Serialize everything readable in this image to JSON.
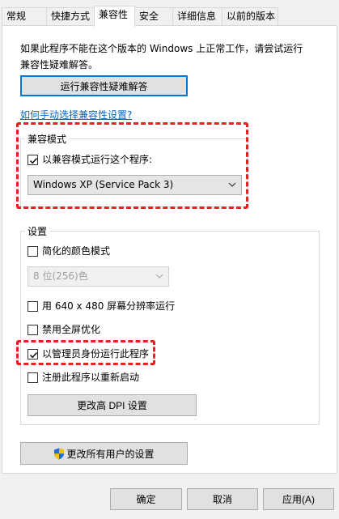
{
  "tabs": [
    "常规",
    "快捷方式",
    "兼容性",
    "安全",
    "详细信息",
    "以前的版本"
  ],
  "active_tab": "兼容性",
  "intro_text": "如果此程序不能在这个版本的 Windows 上正常工作，请尝试运行兼容性疑难解答。",
  "troubleshooter_button": "运行兼容性疑难解答",
  "manual_link": "如何手动选择兼容性设置?",
  "compat_mode": {
    "title": "兼容模式",
    "checkbox_label": "以兼容模式运行这个程序:",
    "checked": true,
    "selected_os": "Windows XP (Service Pack 3)"
  },
  "settings": {
    "title": "设置",
    "reduced_color": {
      "label": "简化的颜色模式",
      "checked": false
    },
    "color_select": "8 位(256)色",
    "run_640": {
      "label": "用 640 x 480 屏幕分辨率运行",
      "checked": false
    },
    "disable_fullscreen": {
      "label": "禁用全屏优化",
      "checked": false
    },
    "run_as_admin": {
      "label": "以管理员身份运行此程序",
      "checked": true
    },
    "register_restart": {
      "label": "注册此程序以重新启动",
      "checked": false
    },
    "dpi_button": "更改高 DPI 设置"
  },
  "all_users_button": "更改所有用户的设置",
  "footer": {
    "ok": "确定",
    "cancel": "取消",
    "apply": "应用(A)"
  },
  "colors": {
    "highlight_red": "#e8201f",
    "link_blue": "#0066cc",
    "focus_blue": "#0078d7"
  }
}
